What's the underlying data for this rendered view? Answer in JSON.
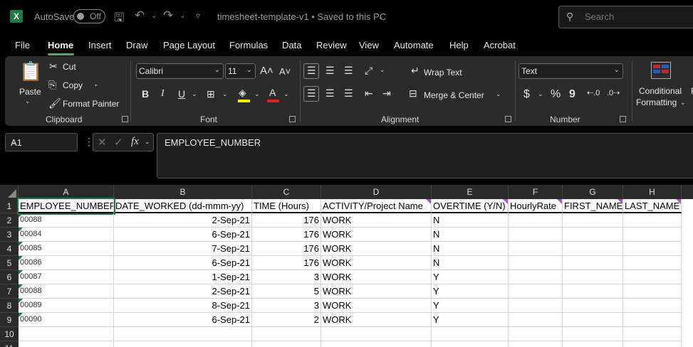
{
  "titlebar": {
    "autosave_label": "AutoSave",
    "toggle_label": "Off",
    "doc_title": "timesheet-template-v1 • Saved to this PC",
    "search_placeholder": "Search"
  },
  "menu": [
    "File",
    "Home",
    "Insert",
    "Draw",
    "Page Layout",
    "Formulas",
    "Data",
    "Review",
    "View",
    "Automate",
    "Help",
    "Acrobat"
  ],
  "ribbon": {
    "clipboard": {
      "paste": "Paste",
      "cut": "Cut",
      "copy": "Copy",
      "format_painter": "Format Painter",
      "label": "Clipboard"
    },
    "font": {
      "name": "Calibri",
      "size": "11",
      "bold": "B",
      "italic": "I",
      "underline": "U",
      "label": "Font"
    },
    "alignment": {
      "wrap_text": "Wrap Text",
      "merge_center": "Merge & Center",
      "label": "Alignment"
    },
    "number": {
      "format": "Text",
      "currency": "$",
      "percent": "%",
      "comma": "9",
      "label": "Number"
    },
    "styles": {
      "conditional_formatting": "Conditional",
      "conditional_formatting_2": "Formatting",
      "cut_letter": "F"
    }
  },
  "formula_bar": {
    "name_box": "A1",
    "fx": "fx",
    "content": "EMPLOYEE_NUMBER"
  },
  "sheet": {
    "columns": [
      "A",
      "B",
      "C",
      "D",
      "E",
      "F",
      "G",
      "H"
    ],
    "rows": [
      "1",
      "2",
      "3",
      "4",
      "5",
      "6",
      "7",
      "8",
      "9",
      "10",
      "11"
    ],
    "header": [
      "EMPLOYEE_NUMBER",
      "DATE_WORKED (dd-mmm-yy)",
      "TIME (Hours)",
      "ACTIVITY/Project Name",
      "OVERTIME (Y/N)",
      "HourlyRate",
      "FIRST_NAME",
      "LAST_NAME"
    ],
    "data": [
      [
        "00088",
        "2-Sep-21",
        "176",
        "WORK",
        "N"
      ],
      [
        "00084",
        "6-Sep-21",
        "176",
        "WORK",
        "N"
      ],
      [
        "00085",
        "7-Sep-21",
        "176",
        "WORK",
        "N"
      ],
      [
        "00086",
        "6-Sep-21",
        "176",
        "WORK",
        "N"
      ],
      [
        "00087",
        "1-Sep-21",
        "3",
        "WORK",
        "Y"
      ],
      [
        "00088",
        "2-Sep-21",
        "5",
        "WORK",
        "Y"
      ],
      [
        "00089",
        "8-Sep-21",
        "3",
        "WORK",
        "Y"
      ],
      [
        "00090",
        "6-Sep-21",
        "2",
        "WORK",
        "Y"
      ]
    ]
  },
  "colors": {
    "accent": "#4faa6e",
    "excel_green": "#1d7a45",
    "comment_marker": "#a855c8"
  }
}
